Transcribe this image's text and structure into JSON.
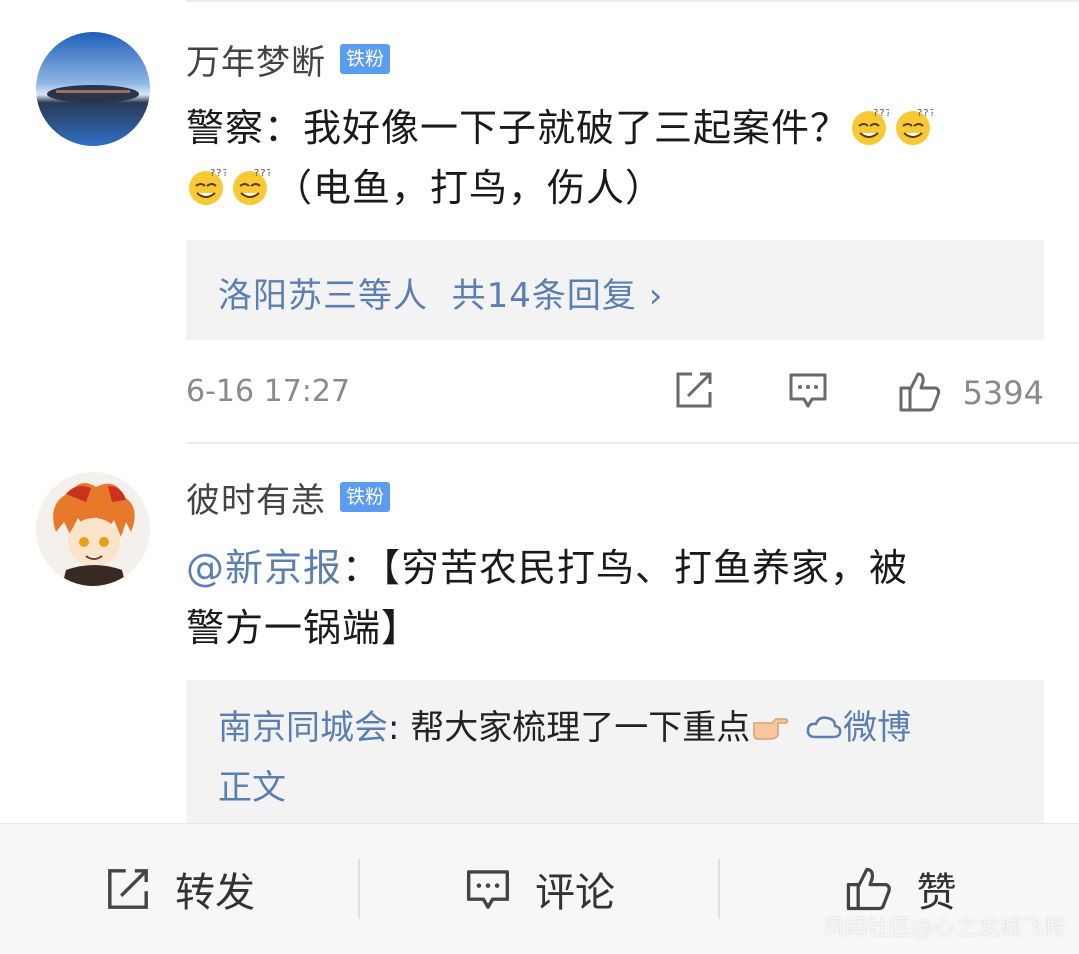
{
  "comment1": {
    "username": "万年梦断",
    "badge": "铁粉",
    "text_a": "警察：我好像一下子就破了三起案件？",
    "text_b": "（电鱼，打鸟，伤人）",
    "emoji_icon": "dizzy-smile-emoji",
    "replies_link": "洛阳苏三等人",
    "replies_count": "共14条回复 ›",
    "timestamp": "6-16 17:27",
    "like_count": "5394"
  },
  "comment2": {
    "username": "彼时有恙",
    "badge": "铁粉",
    "mention": "@新京报",
    "text_a": "：【穷苦农民打鸟、打鱼养家，被",
    "text_b": "警方一锅端】",
    "quote_author": "南京同城会",
    "quote_text": ": 帮大家梳理了一下重点",
    "quote_link_a": "微博",
    "quote_link_b": "正文"
  },
  "bottom_bar": {
    "repost_label": "转发",
    "comment_label": "评论",
    "like_label": "赞"
  },
  "watermark": "风闻社区@心之龙城飞将",
  "colors": {
    "link_blue": "#5b7fb0",
    "badge_blue": "#5b9cf0",
    "meta_gray": "#8a8a8a"
  }
}
